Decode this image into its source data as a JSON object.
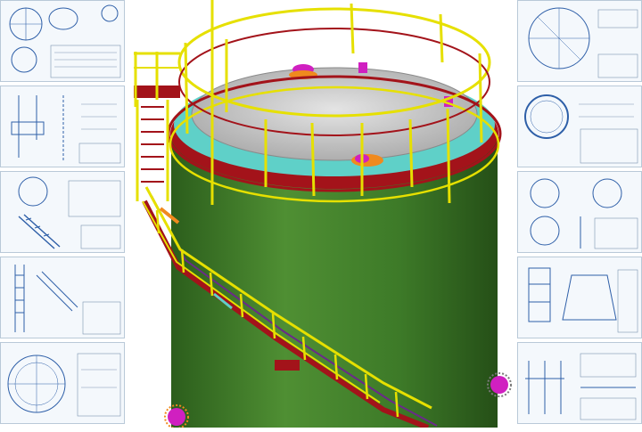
{
  "scene": {
    "subject": "vertical-steel-storage-tank-3d-model",
    "colors": {
      "shell": "#3f7f2a",
      "shell_dark": "#2c5e1c",
      "roof": "#cfcfcf",
      "railing": "#e6e000",
      "red_trim": "#a3131a",
      "cyan_platform": "#5fd0c8",
      "nozzle_magenta": "#d020c0",
      "nozzle_orange": "#f08a1e",
      "drawing_line": "#2e5fa8",
      "sheet_bg": "#f4f8fc"
    }
  },
  "left_sheets": [
    {
      "id": "sheet-l1"
    },
    {
      "id": "sheet-l2"
    },
    {
      "id": "sheet-l3"
    },
    {
      "id": "sheet-l4"
    },
    {
      "id": "sheet-l5"
    }
  ],
  "right_sheets": [
    {
      "id": "sheet-r1"
    },
    {
      "id": "sheet-r2"
    },
    {
      "id": "sheet-r3"
    },
    {
      "id": "sheet-r4"
    },
    {
      "id": "sheet-r5"
    }
  ]
}
